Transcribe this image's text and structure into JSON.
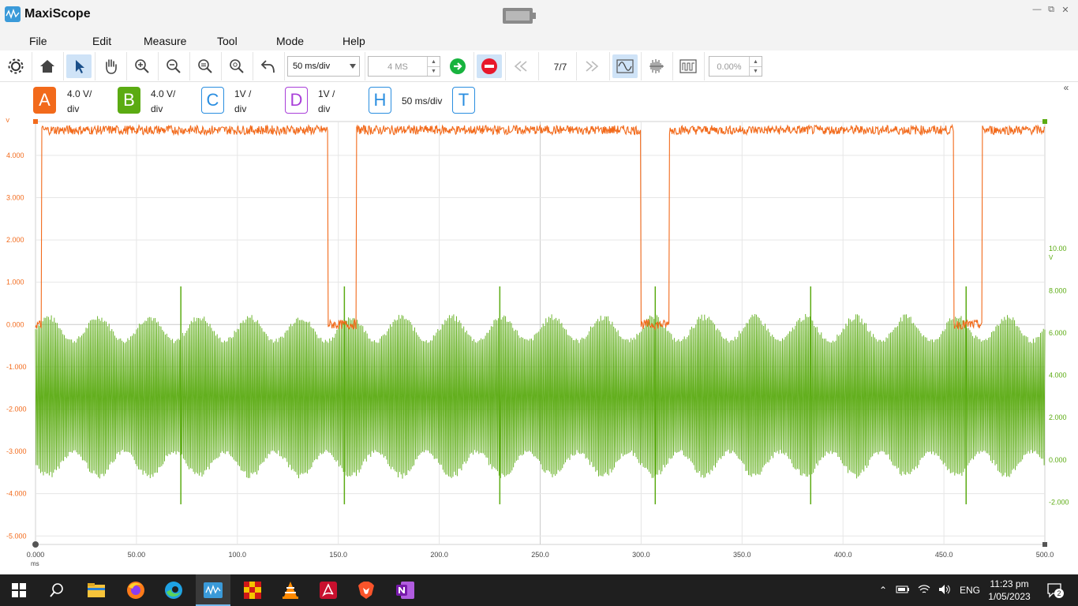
{
  "app": {
    "title": "MaxiScope"
  },
  "window_controls": [
    "minimize",
    "restore",
    "close"
  ],
  "menu": [
    "File",
    "Edit",
    "Measure",
    "Tool",
    "Mode",
    "Help"
  ],
  "toolbar": {
    "timebase_select": "50  ms/div",
    "record_length": "4 MS",
    "page_indicator": "7/7",
    "trigger_position": "0.00%"
  },
  "channels": [
    {
      "letter": "A",
      "color": "#f26a1b",
      "style": "filled",
      "scale_line1": "4.0 V/",
      "scale_line2": "div"
    },
    {
      "letter": "B",
      "color": "#5bab12",
      "style": "filled",
      "scale_line1": "4.0 V/",
      "scale_line2": "div"
    },
    {
      "letter": "C",
      "color": "#2a8ee0",
      "style": "outline",
      "scale_line1": "1V /",
      "scale_line2": "div"
    },
    {
      "letter": "D",
      "color": "#a93fd9",
      "style": "outline",
      "scale_line1": "1V /",
      "scale_line2": "div"
    },
    {
      "letter": "H",
      "color": "#2a8ee0",
      "style": "outline",
      "scale_line1": "50  ms/div",
      "scale_line2": ""
    },
    {
      "letter": "T",
      "color": "#2a8ee0",
      "style": "outline",
      "scale_line1": "",
      "scale_line2": ""
    }
  ],
  "chart_data": {
    "type": "line",
    "x_unit": "ms",
    "x_ticks": [
      "0.000",
      "50.00",
      "100.0",
      "150.0",
      "200.0",
      "250.0",
      "300.0",
      "350.0",
      "400.0",
      "450.0",
      "500.0"
    ],
    "left_axis": {
      "unit": "V",
      "color": "#f26a1b",
      "ticks": [
        "4.000",
        "3.000",
        "2.000",
        "1.000",
        "0.000",
        "-1.000",
        "-2.000",
        "-3.000",
        "-4.000",
        "-5.000"
      ],
      "range": [
        -5.2,
        4.8
      ]
    },
    "right_axis": {
      "unit": "V",
      "color": "#5bab12",
      "ticks": [
        "10.00",
        "8.000",
        "6.000",
        "4.000",
        "2.000",
        "0.000",
        "-2.000"
      ],
      "range": [
        -4.0,
        16.0
      ]
    },
    "grid": true,
    "series": [
      {
        "channel": "A",
        "color": "#f26a1b",
        "kind": "square wave",
        "high_v": 4.6,
        "low_v": 0.0,
        "low_intervals_ms": [
          [
            0,
            3
          ],
          [
            145,
            159
          ],
          [
            300,
            314
          ],
          [
            455,
            469
          ]
        ]
      },
      {
        "channel": "B",
        "color": "#5bab12",
        "kind": "oscillation",
        "center_v": 3.0,
        "amplitude_v": 3.9,
        "spike_times_ms": [
          72,
          153,
          230,
          307,
          384,
          461
        ]
      }
    ]
  },
  "taskbar": {
    "apps": [
      "start",
      "search",
      "file-explorer",
      "firefox",
      "edge",
      "maxiscope",
      "app-grid",
      "vlc",
      "acrobat",
      "brave",
      "onenote"
    ],
    "language": "ENG",
    "time": "11:23 pm",
    "date": "1/05/2023",
    "notification_count": "2"
  }
}
